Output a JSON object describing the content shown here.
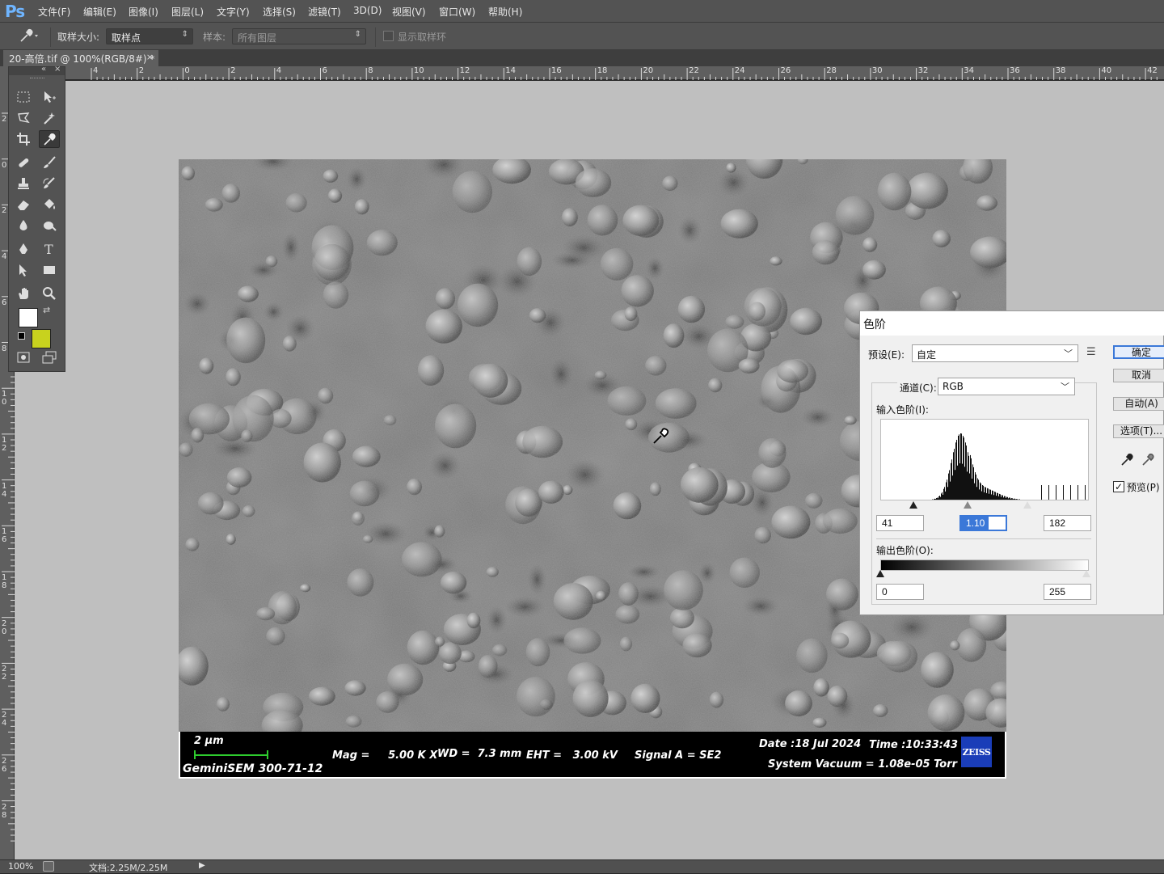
{
  "app": {
    "logo": "Ps"
  },
  "menu": [
    "文件(F)",
    "编辑(E)",
    "图像(I)",
    "图层(L)",
    "文字(Y)",
    "选择(S)",
    "滤镜(T)",
    "3D(D)",
    "视图(V)",
    "窗口(W)",
    "帮助(H)"
  ],
  "options": {
    "sample_size_label": "取样大小:",
    "sample_size_value": "取样点",
    "sample_label": "样本:",
    "sample_value": "所有图层",
    "show_ring_label": "显示取样环",
    "show_ring_checked": false
  },
  "document_tab": {
    "title": "20-高倍.tif @ 100%(RGB/8#) *",
    "close": "×"
  },
  "ruler": {
    "h_labels": [
      "4",
      "2",
      "0",
      "2",
      "4",
      "6",
      "8",
      "10",
      "12",
      "14",
      "16",
      "18",
      "20",
      "22",
      "24",
      "26",
      "28",
      "30",
      "32",
      "34",
      "36",
      "38",
      "40",
      "42"
    ],
    "v_labels": [
      "2",
      "0",
      "2",
      "4",
      "6",
      "8",
      "10",
      "12",
      "14",
      "16",
      "18",
      "20",
      "22",
      "24",
      "26",
      "28"
    ]
  },
  "toolbox": {
    "collapse": "«",
    "close": "×",
    "foreground_color": "#ffffff",
    "background_color": "#c8d21e"
  },
  "sem": {
    "scale": "2 μm",
    "instrument": "GeminiSEM 300-71-12",
    "mag": "Mag =     5.00 K X",
    "wd": "WD =  7.3 mm",
    "eht": "EHT =   3.00 kV",
    "signal": "Signal A = SE2",
    "date": "Date :18 Jul 2024",
    "time": "Time :10:33:43",
    "vacuum": "System Vacuum = 1.08e-05 Torr",
    "logo": "ZEISS"
  },
  "status": {
    "zoom": "100%",
    "doc": "文档:2.25M/2.25M"
  },
  "levels": {
    "title": "色阶",
    "preset_label": "预设(E):",
    "preset_value": "自定",
    "channel_label": "通道(C):",
    "channel_value": "RGB",
    "input_label": "输入色阶(I):",
    "input_black": "41",
    "input_gamma": "1.10",
    "input_white": "182",
    "output_label": "输出色阶(O):",
    "output_black": "0",
    "output_white": "255",
    "btn_ok": "确定",
    "btn_cancel": "取消",
    "btn_auto": "自动(A)",
    "btn_options": "选项(T)...",
    "preview_label": "预览(P)",
    "preview_checked": true
  }
}
